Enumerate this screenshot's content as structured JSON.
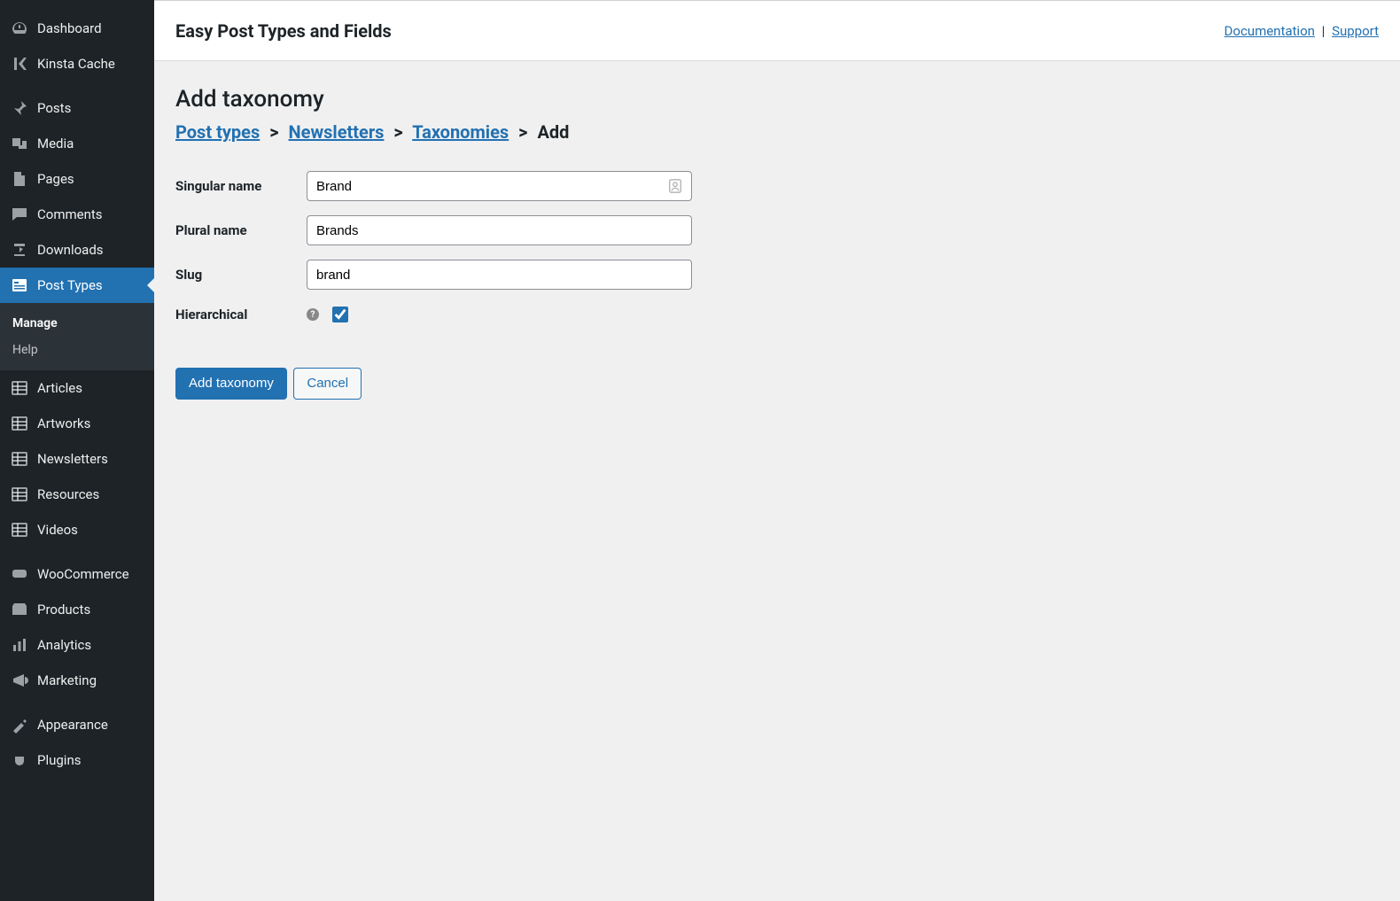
{
  "sidebar": {
    "top": [
      {
        "label": "Dashboard",
        "icon": "dashboard-icon"
      },
      {
        "label": "Kinsta Cache",
        "icon": "kinsta-icon"
      }
    ],
    "section1": [
      {
        "label": "Posts",
        "icon": "pin-icon"
      },
      {
        "label": "Media",
        "icon": "media-icon"
      },
      {
        "label": "Pages",
        "icon": "page-icon"
      },
      {
        "label": "Comments",
        "icon": "comment-icon"
      },
      {
        "label": "Downloads",
        "icon": "download-icon"
      },
      {
        "label": "Post Types",
        "icon": "post-types-icon",
        "active": true
      }
    ],
    "submenu": [
      {
        "label": "Manage",
        "active": true
      },
      {
        "label": "Help"
      }
    ],
    "section2": [
      {
        "label": "Articles",
        "icon": "list-icon"
      },
      {
        "label": "Artworks",
        "icon": "list-icon"
      },
      {
        "label": "Newsletters",
        "icon": "list-icon"
      },
      {
        "label": "Resources",
        "icon": "list-icon"
      },
      {
        "label": "Videos",
        "icon": "list-icon"
      }
    ],
    "section3": [
      {
        "label": "WooCommerce",
        "icon": "woo-icon"
      },
      {
        "label": "Products",
        "icon": "products-icon"
      },
      {
        "label": "Analytics",
        "icon": "analytics-icon"
      },
      {
        "label": "Marketing",
        "icon": "marketing-icon"
      }
    ],
    "section4": [
      {
        "label": "Appearance",
        "icon": "appearance-icon"
      },
      {
        "label": "Plugins",
        "icon": "plugins-icon"
      }
    ]
  },
  "topbar": {
    "title": "Easy Post Types and Fields",
    "links": {
      "documentation": "Documentation",
      "support": "Support"
    }
  },
  "page": {
    "heading": "Add taxonomy",
    "breadcrumb": {
      "post_types": "Post types",
      "newsletters": "Newsletters",
      "taxonomies": "Taxonomies",
      "add": "Add",
      "sep": ">"
    },
    "form": {
      "singular_label": "Singular name",
      "singular_value": "Brand",
      "plural_label": "Plural name",
      "plural_value": "Brands",
      "slug_label": "Slug",
      "slug_value": "brand",
      "hierarchical_label": "Hierarchical",
      "hierarchical_checked": true
    },
    "actions": {
      "submit": "Add taxonomy",
      "cancel": "Cancel"
    }
  }
}
